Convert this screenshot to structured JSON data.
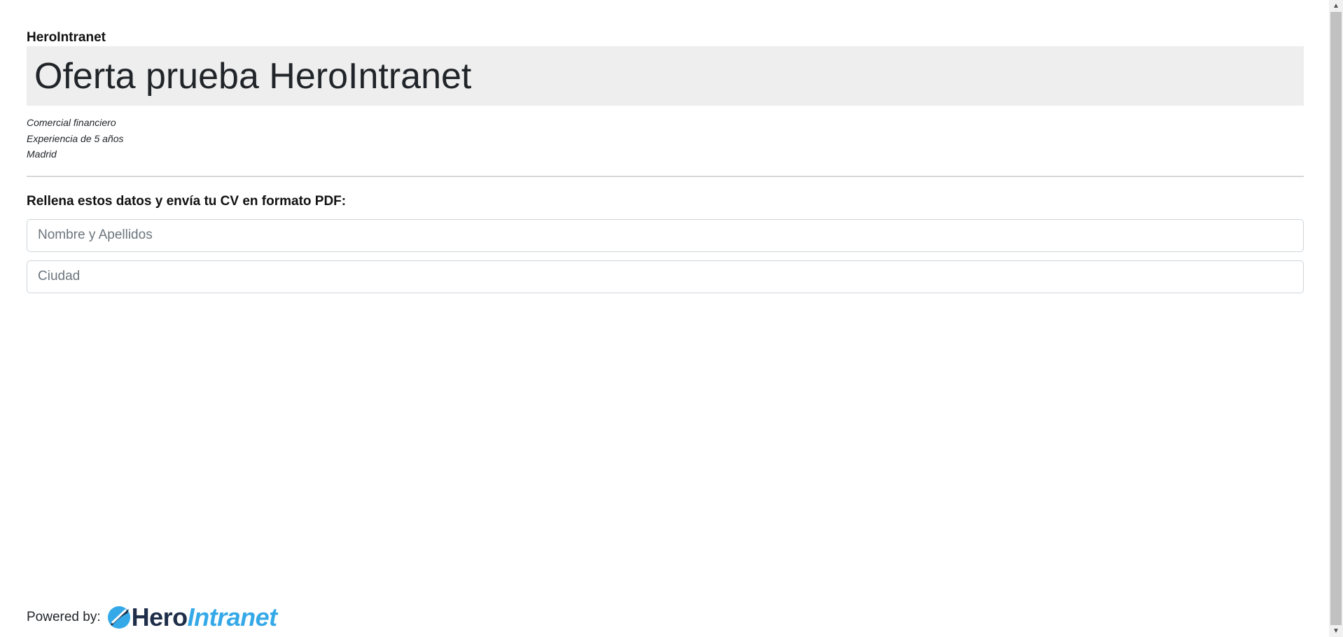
{
  "header": {
    "brand": "HeroIntranet",
    "title": "Oferta prueba HeroIntranet"
  },
  "offer": {
    "position": "Comercial financiero",
    "experience": "Experiencia de 5 años",
    "location": "Madrid"
  },
  "form": {
    "heading": "Rellena estos datos y envía tu CV en formato PDF:",
    "name_placeholder": "Nombre y Apellidos",
    "city_placeholder": "Ciudad"
  },
  "footer": {
    "powered_by": "Powered by:",
    "logo_part1": "Hero",
    "logo_part2": "Intranet"
  },
  "colors": {
    "logo_dark": "#1f2f4a",
    "logo_blue": "#35a9e8",
    "jumbotron_bg": "#eeeeee"
  },
  "icons": {
    "scroll_up": "triangle-up-icon",
    "scroll_down": "triangle-down-icon",
    "logo_mark": "hero-swoosh-logo-icon"
  }
}
